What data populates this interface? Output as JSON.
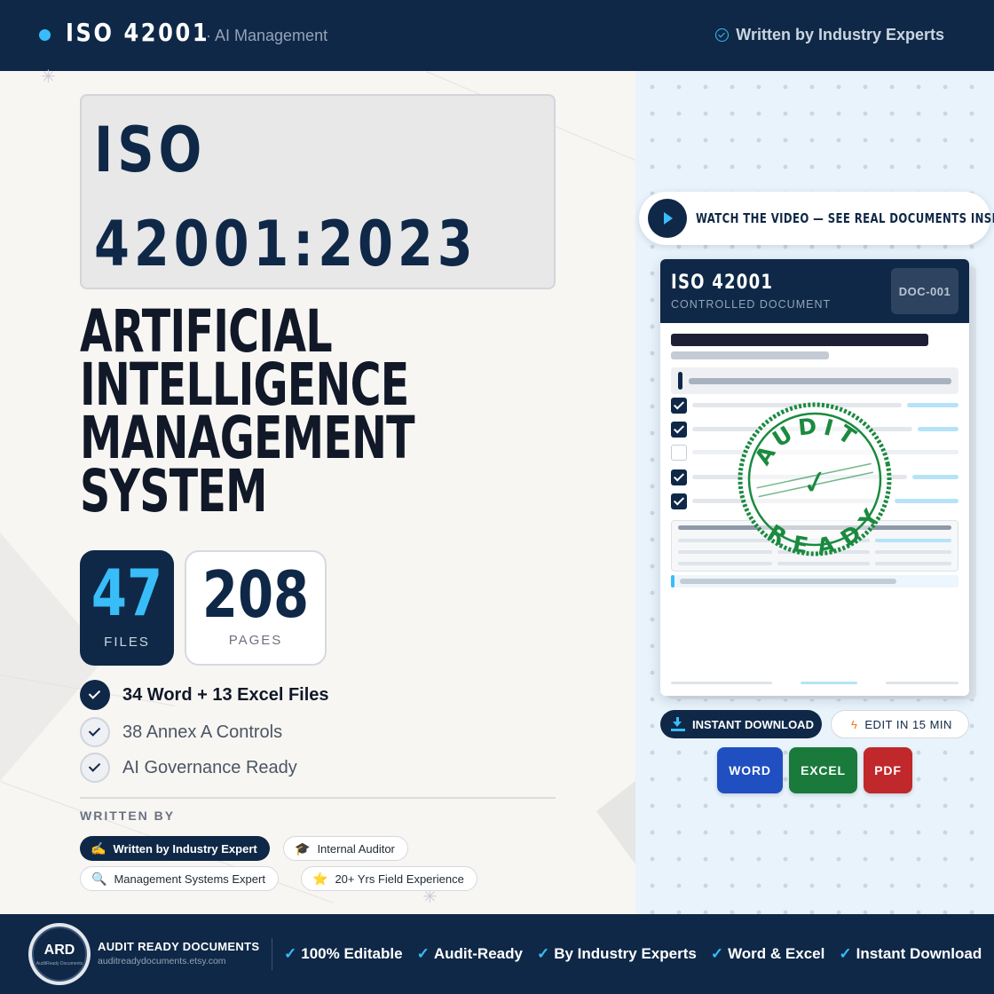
{
  "header": {
    "brand": "ISO 42001",
    "subtitle": "· AI Management",
    "badge": "Written by Industry Experts"
  },
  "hero": {
    "title_line1": "ISO",
    "title_line2": "42001:2023",
    "heading_lines": [
      "ARTIFICIAL",
      "INTELLIGENCE",
      "MANAGEMENT",
      "SYSTEM"
    ]
  },
  "stats": [
    {
      "number": "47",
      "label": "FILES"
    },
    {
      "number": "208",
      "label": "PAGES"
    }
  ],
  "features": [
    "34 Word + 13 Excel Files",
    "38 Annex A Controls",
    "AI Governance Ready"
  ],
  "written_by": {
    "label": "WRITTEN BY",
    "chips": [
      {
        "icon": "✍️",
        "text": "Written by Industry Expert"
      },
      {
        "icon": "🎓",
        "text": "Internal Auditor"
      },
      {
        "icon": "🔍",
        "text": "Management Systems Expert"
      },
      {
        "icon": "⭐",
        "text": "20+ Yrs Field Experience"
      }
    ]
  },
  "video": {
    "label": "WATCH THE VIDEO — SEE REAL DOCUMENTS INSIDE"
  },
  "document": {
    "title": "ISO 42001",
    "subtitle": "CONTROLLED DOCUMENT",
    "id": "DOC-001",
    "stamp_top": "AUDIT",
    "stamp_bottom": "READY",
    "stamp_mark": "✓",
    "checklist_checked": [
      true,
      true,
      false,
      true,
      true
    ]
  },
  "actions": {
    "download": "INSTANT DOWNLOAD",
    "edit": "EDIT IN 15 MIN"
  },
  "formats": [
    "WORD",
    "EXCEL",
    "PDF"
  ],
  "colors": {
    "navy": "#0f2847",
    "accent": "#38bdf8",
    "stamp_green": "#1a8a3f",
    "word_blue": "#1f4fc1",
    "excel_green": "#1a7a3c",
    "pdf_red": "#c0282b"
  },
  "footer": {
    "logo_text": "ARD",
    "logo_small": "AuditReady Documents",
    "brand": "AUDIT READY DOCUMENTS",
    "url": "auditreadydocuments.etsy.com",
    "check": "✓",
    "items": [
      "100% Editable",
      "Audit-Ready",
      "By Industry Experts",
      "Word & Excel",
      "Instant Download"
    ]
  }
}
